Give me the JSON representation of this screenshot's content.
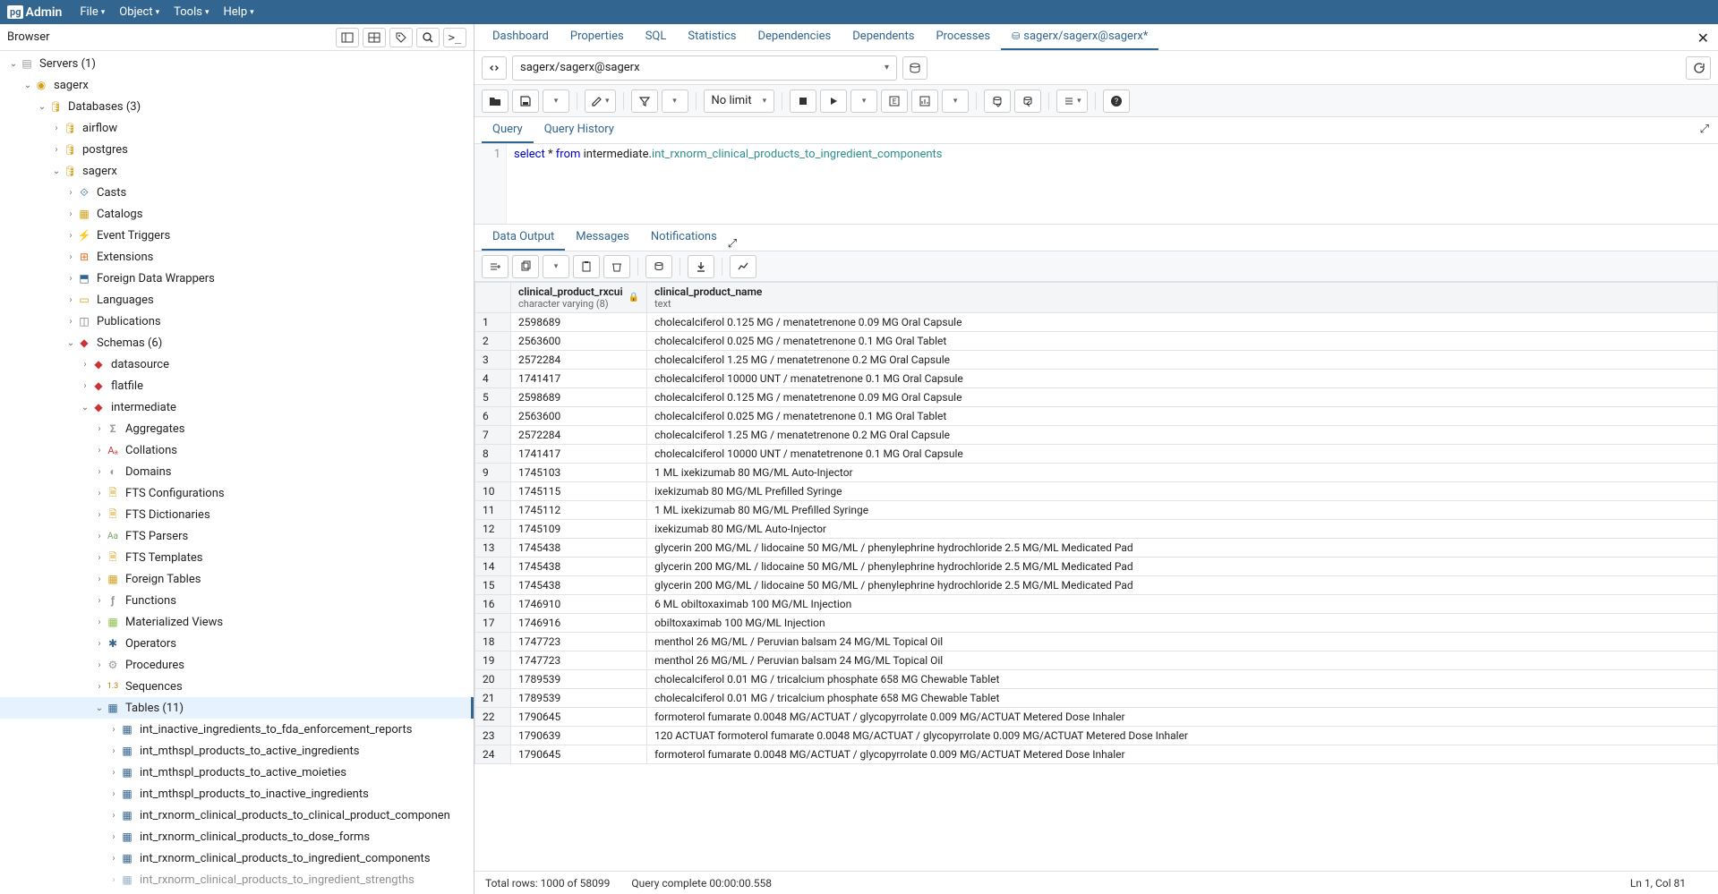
{
  "app": {
    "logo_box": "pg",
    "logo_text": "Admin"
  },
  "menubar": [
    "File",
    "Object",
    "Tools",
    "Help"
  ],
  "browser": {
    "title": "Browser",
    "toolbar_icons": [
      "panel-icon",
      "grid-icon",
      "tag-icon",
      "search-icon",
      "terminal-icon"
    ]
  },
  "tree": [
    {
      "depth": 0,
      "toggle": "v",
      "icon": "i-server",
      "label": "Servers (1)"
    },
    {
      "depth": 1,
      "toggle": "v",
      "icon": "i-server-connected",
      "label": "sagerx"
    },
    {
      "depth": 2,
      "toggle": "v",
      "icon": "i-db-gold",
      "label": "Databases (3)"
    },
    {
      "depth": 3,
      "toggle": ">",
      "icon": "i-db-gold",
      "label": "airflow"
    },
    {
      "depth": 3,
      "toggle": ">",
      "icon": "i-db-gold",
      "label": "postgres"
    },
    {
      "depth": 3,
      "toggle": "v",
      "icon": "i-db-gold",
      "label": "sagerx"
    },
    {
      "depth": 4,
      "toggle": ">",
      "icon": "i-cast",
      "label": "Casts"
    },
    {
      "depth": 4,
      "toggle": ">",
      "icon": "i-catalog",
      "label": "Catalogs"
    },
    {
      "depth": 4,
      "toggle": ">",
      "icon": "i-trigger",
      "label": "Event Triggers"
    },
    {
      "depth": 4,
      "toggle": ">",
      "icon": "i-ext",
      "label": "Extensions"
    },
    {
      "depth": 4,
      "toggle": ">",
      "icon": "i-fdw",
      "label": "Foreign Data Wrappers"
    },
    {
      "depth": 4,
      "toggle": ">",
      "icon": "i-lang",
      "label": "Languages"
    },
    {
      "depth": 4,
      "toggle": ">",
      "icon": "i-pub",
      "label": "Publications"
    },
    {
      "depth": 4,
      "toggle": "v",
      "icon": "i-schema",
      "label": "Schemas (6)"
    },
    {
      "depth": 5,
      "toggle": ">",
      "icon": "i-schema",
      "label": "datasource"
    },
    {
      "depth": 5,
      "toggle": ">",
      "icon": "i-schema",
      "label": "flatfile"
    },
    {
      "depth": 5,
      "toggle": "v",
      "icon": "i-schema",
      "label": "intermediate"
    },
    {
      "depth": 6,
      "toggle": ">",
      "icon": "i-agg",
      "label": "Aggregates"
    },
    {
      "depth": 6,
      "toggle": ">",
      "icon": "i-coll",
      "label": "Collations"
    },
    {
      "depth": 6,
      "toggle": ">",
      "icon": "i-domain",
      "label": "Domains"
    },
    {
      "depth": 6,
      "toggle": ">",
      "icon": "i-fts",
      "label": "FTS Configurations"
    },
    {
      "depth": 6,
      "toggle": ">",
      "icon": "i-fts",
      "label": "FTS Dictionaries"
    },
    {
      "depth": 6,
      "toggle": ">",
      "icon": "i-ftsparse",
      "label": "FTS Parsers"
    },
    {
      "depth": 6,
      "toggle": ">",
      "icon": "i-fts",
      "label": "FTS Templates"
    },
    {
      "depth": 6,
      "toggle": ">",
      "icon": "i-foreign",
      "label": "Foreign Tables"
    },
    {
      "depth": 6,
      "toggle": ">",
      "icon": "i-func",
      "label": "Functions"
    },
    {
      "depth": 6,
      "toggle": ">",
      "icon": "i-matview",
      "label": "Materialized Views"
    },
    {
      "depth": 6,
      "toggle": ">",
      "icon": "i-oper",
      "label": "Operators"
    },
    {
      "depth": 6,
      "toggle": ">",
      "icon": "i-proc",
      "label": "Procedures"
    },
    {
      "depth": 6,
      "toggle": ">",
      "icon": "i-seq",
      "label": "Sequences"
    },
    {
      "depth": 6,
      "toggle": "v",
      "icon": "i-tables",
      "label": "Tables (11)",
      "selected": true
    },
    {
      "depth": 7,
      "toggle": ">",
      "icon": "i-table",
      "label": "int_inactive_ingredients_to_fda_enforcement_reports"
    },
    {
      "depth": 7,
      "toggle": ">",
      "icon": "i-table",
      "label": "int_mthspl_products_to_active_ingredients"
    },
    {
      "depth": 7,
      "toggle": ">",
      "icon": "i-table",
      "label": "int_mthspl_products_to_active_moieties"
    },
    {
      "depth": 7,
      "toggle": ">",
      "icon": "i-table",
      "label": "int_mthspl_products_to_inactive_ingredients"
    },
    {
      "depth": 7,
      "toggle": ">",
      "icon": "i-table",
      "label": "int_rxnorm_clinical_products_to_clinical_product_componen"
    },
    {
      "depth": 7,
      "toggle": ">",
      "icon": "i-table",
      "label": "int_rxnorm_clinical_products_to_dose_forms"
    },
    {
      "depth": 7,
      "toggle": ">",
      "icon": "i-table",
      "label": "int_rxnorm_clinical_products_to_ingredient_components"
    },
    {
      "depth": 7,
      "toggle": ">",
      "icon": "i-table",
      "label": "int_rxnorm_clinical_products_to_ingredient_strengths",
      "faded": true
    }
  ],
  "tabs": {
    "items": [
      "Dashboard",
      "Properties",
      "SQL",
      "Statistics",
      "Dependencies",
      "Dependents",
      "Processes"
    ],
    "active_query_tab": "sagerx/sagerx@sagerx*"
  },
  "connection": {
    "label": "sagerx/sagerx@sagerx"
  },
  "toolbar": {
    "no_limit": "No limit"
  },
  "query_tabs": {
    "query": "Query",
    "history": "Query History"
  },
  "editor": {
    "line_no": "1",
    "kw_select": "select",
    "star": " * ",
    "kw_from": "from",
    "schema": " intermediate.",
    "table": "int_rxnorm_clinical_products_to_ingredient_components"
  },
  "output_tabs": {
    "data": "Data Output",
    "messages": "Messages",
    "notifications": "Notifications"
  },
  "columns": [
    {
      "name": "clinical_product_rxcui",
      "type": "character varying (8)",
      "lock": true
    },
    {
      "name": "clinical_product_name",
      "type": "text",
      "lock": false
    }
  ],
  "rows": [
    {
      "n": 1,
      "c0": "2598689",
      "c1": "cholecalciferol 0.125 MG / menatetrenone 0.09 MG Oral Capsule"
    },
    {
      "n": 2,
      "c0": "2563600",
      "c1": "cholecalciferol 0.025 MG / menatetrenone 0.1 MG Oral Tablet"
    },
    {
      "n": 3,
      "c0": "2572284",
      "c1": "cholecalciferol 1.25 MG / menatetrenone 0.2 MG Oral Capsule"
    },
    {
      "n": 4,
      "c0": "1741417",
      "c1": "cholecalciferol 10000 UNT / menatetrenone 0.1 MG Oral Capsule"
    },
    {
      "n": 5,
      "c0": "2598689",
      "c1": "cholecalciferol 0.125 MG / menatetrenone 0.09 MG Oral Capsule"
    },
    {
      "n": 6,
      "c0": "2563600",
      "c1": "cholecalciferol 0.025 MG / menatetrenone 0.1 MG Oral Tablet"
    },
    {
      "n": 7,
      "c0": "2572284",
      "c1": "cholecalciferol 1.25 MG / menatetrenone 0.2 MG Oral Capsule"
    },
    {
      "n": 8,
      "c0": "1741417",
      "c1": "cholecalciferol 10000 UNT / menatetrenone 0.1 MG Oral Capsule"
    },
    {
      "n": 9,
      "c0": "1745103",
      "c1": "1 ML ixekizumab 80 MG/ML Auto-Injector"
    },
    {
      "n": 10,
      "c0": "1745115",
      "c1": "ixekizumab 80 MG/ML Prefilled Syringe"
    },
    {
      "n": 11,
      "c0": "1745112",
      "c1": "1 ML ixekizumab 80 MG/ML Prefilled Syringe"
    },
    {
      "n": 12,
      "c0": "1745109",
      "c1": "ixekizumab 80 MG/ML Auto-Injector"
    },
    {
      "n": 13,
      "c0": "1745438",
      "c1": "glycerin 200 MG/ML / lidocaine 50 MG/ML / phenylephrine hydrochloride 2.5 MG/ML Medicated Pad"
    },
    {
      "n": 14,
      "c0": "1745438",
      "c1": "glycerin 200 MG/ML / lidocaine 50 MG/ML / phenylephrine hydrochloride 2.5 MG/ML Medicated Pad"
    },
    {
      "n": 15,
      "c0": "1745438",
      "c1": "glycerin 200 MG/ML / lidocaine 50 MG/ML / phenylephrine hydrochloride 2.5 MG/ML Medicated Pad"
    },
    {
      "n": 16,
      "c0": "1746910",
      "c1": "6 ML obiltoxaximab 100 MG/ML Injection"
    },
    {
      "n": 17,
      "c0": "1746916",
      "c1": "obiltoxaximab 100 MG/ML Injection"
    },
    {
      "n": 18,
      "c0": "1747723",
      "c1": "menthol 26 MG/ML / Peruvian balsam 24 MG/ML Topical Oil"
    },
    {
      "n": 19,
      "c0": "1747723",
      "c1": "menthol 26 MG/ML / Peruvian balsam 24 MG/ML Topical Oil"
    },
    {
      "n": 20,
      "c0": "1789539",
      "c1": "cholecalciferol 0.01 MG / tricalcium phosphate 658 MG Chewable Tablet"
    },
    {
      "n": 21,
      "c0": "1789539",
      "c1": "cholecalciferol 0.01 MG / tricalcium phosphate 658 MG Chewable Tablet"
    },
    {
      "n": 22,
      "c0": "1790645",
      "c1": "formoterol fumarate 0.0048 MG/ACTUAT / glycopyrrolate 0.009 MG/ACTUAT Metered Dose Inhaler"
    },
    {
      "n": 23,
      "c0": "1790639",
      "c1": "120 ACTUAT formoterol fumarate 0.0048 MG/ACTUAT / glycopyrrolate 0.009 MG/ACTUAT Metered Dose Inhaler"
    },
    {
      "n": 24,
      "c0": "1790645",
      "c1": "formoterol fumarate 0.0048 MG/ACTUAT / glycopyrrolate 0.009 MG/ACTUAT Metered Dose Inhaler"
    }
  ],
  "status": {
    "rows": "Total rows: 1000 of 58099",
    "complete": "Query complete 00:00:00.558",
    "cursor": "Ln 1, Col 81"
  }
}
